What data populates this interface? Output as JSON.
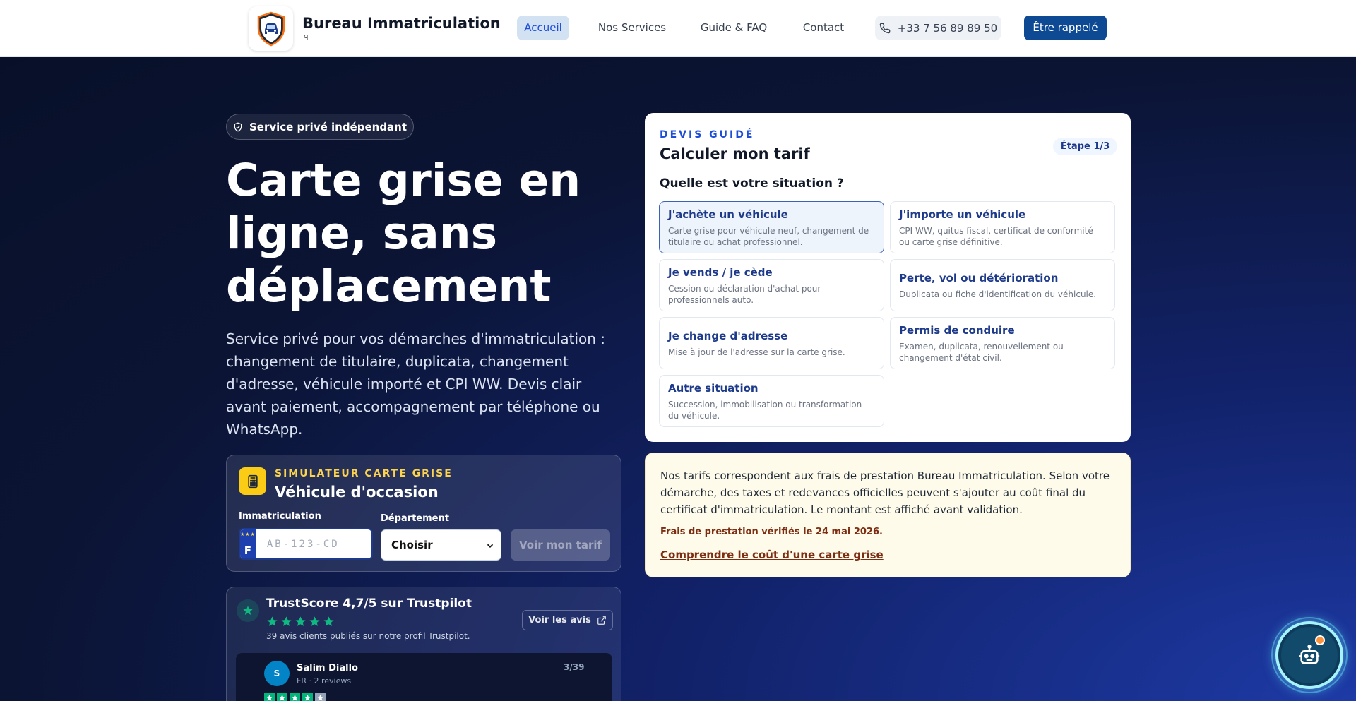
{
  "header": {
    "brand_name": "Bureau Immatriculation",
    "brand_sub": "ꟼ",
    "nav": [
      {
        "label": "Accueil",
        "active": true
      },
      {
        "label": "Nos Services",
        "active": false
      },
      {
        "label": "Guide & FAQ",
        "active": false
      },
      {
        "label": "Contact",
        "active": false
      }
    ],
    "phone": "+33 7 56 89 89 50",
    "cta": "Être rappelé"
  },
  "hero": {
    "badge": "Service privé indépendant",
    "title": "Carte grise en ligne, sans déplacement",
    "description": "Service privé pour vos démarches d'immatriculation : changement de titulaire, duplicata, changement d'adresse, véhicule importé et CPI WW. Devis clair avant paiement, accompagnement par téléphone ou WhatsApp."
  },
  "simulator": {
    "kicker": "SIMULATEUR CARTE GRISE",
    "title": "Véhicule d'occasion",
    "plate_label": "Immatriculation",
    "plate_country": "F",
    "plate_placeholder": "AB-123-CD",
    "dept_label": "Département",
    "dept_value": "Choisir",
    "submit": "Voir mon tarif"
  },
  "trustpilot": {
    "title": "TrustScore 4,7/5 sur Trustpilot",
    "subtitle": "39 avis clients publiés sur notre profil Trustpilot.",
    "button": "Voir les avis",
    "review": {
      "initial": "S",
      "name": "Salim Diallo",
      "meta": "FR · 2 reviews",
      "count": "3/39"
    }
  },
  "quote": {
    "kicker": "DEVIS GUIDÉ",
    "title": "Calculer mon tarif",
    "step": "Étape 1/3",
    "question": "Quelle est votre situation ?",
    "options": [
      {
        "title": "J'achète un véhicule",
        "desc": "Carte grise pour véhicule neuf, changement de titulaire ou achat professionnel."
      },
      {
        "title": "J'importe un véhicule",
        "desc": "CPI WW, quitus fiscal, certificat de conformité ou carte grise définitive."
      },
      {
        "title": "Je vends / je cède",
        "desc": "Cession ou déclaration d'achat pour professionnels auto."
      },
      {
        "title": "Perte, vol ou détérioration",
        "desc": "Duplicata ou fiche d'identification du véhicule."
      },
      {
        "title": "Je change d'adresse",
        "desc": "Mise à jour de l'adresse sur la carte grise."
      },
      {
        "title": "Permis de conduire",
        "desc": "Examen, duplicata, renouvellement ou changement d'état civil."
      },
      {
        "title": "Autre situation",
        "desc": "Succession, immobilisation ou transformation du véhicule."
      }
    ]
  },
  "info": {
    "text": "Nos tarifs correspondent aux frais de prestation Bureau Immatriculation. Selon votre démarche, des taxes et redevances officielles peuvent s'ajouter au coût final du certificat d'immatriculation. Le montant est affiché avant validation.",
    "date": "Frais de prestation vérifiés le 24 mai 2026.",
    "link": "Comprendre le coût d'une carte grise"
  },
  "colors": {
    "brand_blue": "#0e4a94",
    "accent_yellow": "#facc15",
    "trust_green": "#00b67a",
    "hero_bg": "#0b1433"
  },
  "icons": [
    "shield-car-logo-icon",
    "phone-icon",
    "shield-check-icon",
    "calculator-icon",
    "star-icon",
    "external-link-icon",
    "chevron-down-icon",
    "robot-icon"
  ]
}
